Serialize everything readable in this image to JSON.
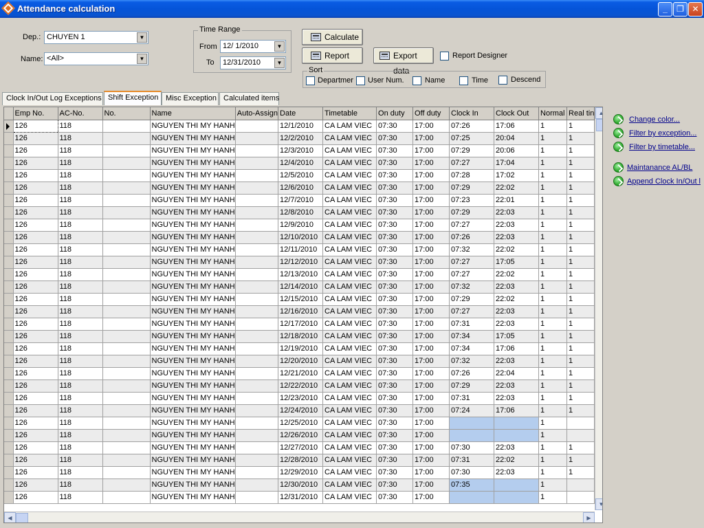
{
  "window": {
    "title": "Attendance calculation",
    "minimize": "_",
    "restore": "❐",
    "close": "✕"
  },
  "filters": {
    "dep_label": "Dep.:",
    "dep_value": "CHUYEN 1",
    "name_label": "Name:",
    "name_value": "<All>"
  },
  "time_range": {
    "title": "Time Range",
    "from_label": "From",
    "from_value": "12/ 1/2010",
    "to_label": "To",
    "to_value": "12/31/2010"
  },
  "actions": {
    "calculate": "Calculate",
    "report": "Report",
    "export": "Export data",
    "report_designer": "Report Designer"
  },
  "sort": {
    "title": "Sort",
    "options": [
      "Departmer",
      "User Num.",
      "Name",
      "Time",
      "Descend"
    ]
  },
  "tabs": [
    {
      "label": "Clock In/Out Log Exceptions"
    },
    {
      "label": "Shift Exception"
    },
    {
      "label": "Misc Exception"
    },
    {
      "label": "Calculated items"
    }
  ],
  "grid": {
    "columns": [
      "Emp No.",
      "AC-No.",
      "No.",
      "Name",
      "Auto-Assign",
      "Date",
      "Timetable",
      "On duty",
      "Off duty",
      "Clock In",
      "Clock Out",
      "Normal",
      "Real tin"
    ],
    "rows": [
      [
        "126",
        "118",
        "",
        "NGUYEN THI MY HANH",
        "",
        "12/1/2010",
        "CA LAM VIEC",
        "07:30",
        "17:00",
        "07:26",
        "17:06",
        "1",
        "1"
      ],
      [
        "126",
        "118",
        "",
        "NGUYEN THI MY HANH",
        "",
        "12/2/2010",
        "CA LAM VIEC",
        "07:30",
        "17:00",
        "07:25",
        "20:04",
        "1",
        "1"
      ],
      [
        "126",
        "118",
        "",
        "NGUYEN THI MY HANH",
        "",
        "12/3/2010",
        "CA LAM VIEC",
        "07:30",
        "17:00",
        "07:29",
        "20:06",
        "1",
        "1"
      ],
      [
        "126",
        "118",
        "",
        "NGUYEN THI MY HANH",
        "",
        "12/4/2010",
        "CA LAM VIEC",
        "07:30",
        "17:00",
        "07:27",
        "17:04",
        "1",
        "1"
      ],
      [
        "126",
        "118",
        "",
        "NGUYEN THI MY HANH",
        "",
        "12/5/2010",
        "CA LAM VIEC",
        "07:30",
        "17:00",
        "07:28",
        "17:02",
        "1",
        "1"
      ],
      [
        "126",
        "118",
        "",
        "NGUYEN THI MY HANH",
        "",
        "12/6/2010",
        "CA LAM VIEC",
        "07:30",
        "17:00",
        "07:29",
        "22:02",
        "1",
        "1"
      ],
      [
        "126",
        "118",
        "",
        "NGUYEN THI MY HANH",
        "",
        "12/7/2010",
        "CA LAM VIEC",
        "07:30",
        "17:00",
        "07:23",
        "22:01",
        "1",
        "1"
      ],
      [
        "126",
        "118",
        "",
        "NGUYEN THI MY HANH",
        "",
        "12/8/2010",
        "CA LAM VIEC",
        "07:30",
        "17:00",
        "07:29",
        "22:03",
        "1",
        "1"
      ],
      [
        "126",
        "118",
        "",
        "NGUYEN THI MY HANH",
        "",
        "12/9/2010",
        "CA LAM VIEC",
        "07:30",
        "17:00",
        "07:27",
        "22:03",
        "1",
        "1"
      ],
      [
        "126",
        "118",
        "",
        "NGUYEN THI MY HANH",
        "",
        "12/10/2010",
        "CA LAM VIEC",
        "07:30",
        "17:00",
        "07:26",
        "22:03",
        "1",
        "1"
      ],
      [
        "126",
        "118",
        "",
        "NGUYEN THI MY HANH",
        "",
        "12/11/2010",
        "CA LAM VIEC",
        "07:30",
        "17:00",
        "07:32",
        "22:02",
        "1",
        "1"
      ],
      [
        "126",
        "118",
        "",
        "NGUYEN THI MY HANH",
        "",
        "12/12/2010",
        "CA LAM VIEC",
        "07:30",
        "17:00",
        "07:27",
        "17:05",
        "1",
        "1"
      ],
      [
        "126",
        "118",
        "",
        "NGUYEN THI MY HANH",
        "",
        "12/13/2010",
        "CA LAM VIEC",
        "07:30",
        "17:00",
        "07:27",
        "22:02",
        "1",
        "1"
      ],
      [
        "126",
        "118",
        "",
        "NGUYEN THI MY HANH",
        "",
        "12/14/2010",
        "CA LAM VIEC",
        "07:30",
        "17:00",
        "07:32",
        "22:03",
        "1",
        "1"
      ],
      [
        "126",
        "118",
        "",
        "NGUYEN THI MY HANH",
        "",
        "12/15/2010",
        "CA LAM VIEC",
        "07:30",
        "17:00",
        "07:29",
        "22:02",
        "1",
        "1"
      ],
      [
        "126",
        "118",
        "",
        "NGUYEN THI MY HANH",
        "",
        "12/16/2010",
        "CA LAM VIEC",
        "07:30",
        "17:00",
        "07:27",
        "22:03",
        "1",
        "1"
      ],
      [
        "126",
        "118",
        "",
        "NGUYEN THI MY HANH",
        "",
        "12/17/2010",
        "CA LAM VIEC",
        "07:30",
        "17:00",
        "07:31",
        "22:03",
        "1",
        "1"
      ],
      [
        "126",
        "118",
        "",
        "NGUYEN THI MY HANH",
        "",
        "12/18/2010",
        "CA LAM VIEC",
        "07:30",
        "17:00",
        "07:34",
        "17:05",
        "1",
        "1"
      ],
      [
        "126",
        "118",
        "",
        "NGUYEN THI MY HANH",
        "",
        "12/19/2010",
        "CA LAM VIEC",
        "07:30",
        "17:00",
        "07:34",
        "17:06",
        "1",
        "1"
      ],
      [
        "126",
        "118",
        "",
        "NGUYEN THI MY HANH",
        "",
        "12/20/2010",
        "CA LAM VIEC",
        "07:30",
        "17:00",
        "07:32",
        "22:03",
        "1",
        "1"
      ],
      [
        "126",
        "118",
        "",
        "NGUYEN THI MY HANH",
        "",
        "12/21/2010",
        "CA LAM VIEC",
        "07:30",
        "17:00",
        "07:26",
        "22:04",
        "1",
        "1"
      ],
      [
        "126",
        "118",
        "",
        "NGUYEN THI MY HANH",
        "",
        "12/22/2010",
        "CA LAM VIEC",
        "07:30",
        "17:00",
        "07:29",
        "22:03",
        "1",
        "1"
      ],
      [
        "126",
        "118",
        "",
        "NGUYEN THI MY HANH",
        "",
        "12/23/2010",
        "CA LAM VIEC",
        "07:30",
        "17:00",
        "07:31",
        "22:03",
        "1",
        "1"
      ],
      [
        "126",
        "118",
        "",
        "NGUYEN THI MY HANH",
        "",
        "12/24/2010",
        "CA LAM VIEC",
        "07:30",
        "17:00",
        "07:24",
        "17:06",
        "1",
        "1"
      ],
      [
        "126",
        "118",
        "",
        "NGUYEN THI MY HANH",
        "",
        "12/25/2010",
        "CA LAM VIEC",
        "07:30",
        "17:00",
        "",
        "",
        "1",
        ""
      ],
      [
        "126",
        "118",
        "",
        "NGUYEN THI MY HANH",
        "",
        "12/26/2010",
        "CA LAM VIEC",
        "07:30",
        "17:00",
        "",
        "",
        "1",
        ""
      ],
      [
        "126",
        "118",
        "",
        "NGUYEN THI MY HANH",
        "",
        "12/27/2010",
        "CA LAM VIEC",
        "07:30",
        "17:00",
        "07:30",
        "22:03",
        "1",
        "1"
      ],
      [
        "126",
        "118",
        "",
        "NGUYEN THI MY HANH",
        "",
        "12/28/2010",
        "CA LAM VIEC",
        "07:30",
        "17:00",
        "07:31",
        "22:02",
        "1",
        "1"
      ],
      [
        "126",
        "118",
        "",
        "NGUYEN THI MY HANH",
        "",
        "12/29/2010",
        "CA LAM VIEC",
        "07:30",
        "17:00",
        "07:30",
        "22:03",
        "1",
        "1"
      ],
      [
        "126",
        "118",
        "",
        "NGUYEN THI MY HANH",
        "",
        "12/30/2010",
        "CA LAM VIEC",
        "07:30",
        "17:00",
        "07:35",
        "",
        "1",
        ""
      ],
      [
        "126",
        "118",
        "",
        "NGUYEN THI MY HANH",
        "",
        "12/31/2010",
        "CA LAM VIEC",
        "07:30",
        "17:00",
        "",
        "",
        "1",
        ""
      ]
    ],
    "highlight_color": "#b4cdee"
  },
  "side_links": [
    "Change color...",
    "Filter by exception...",
    "Filter by timetable...",
    "Maintanance AL/BL",
    "Append Clock In/Out l"
  ],
  "icons": {
    "window": "app-diamond-icon",
    "buttons": "calculator-icon",
    "side_links": "green-check-arrow-icon"
  }
}
